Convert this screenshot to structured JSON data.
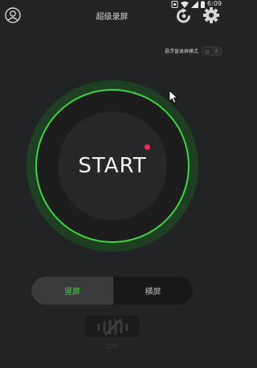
{
  "status": {
    "time": "6:09"
  },
  "header": {
    "title": "超级录屏"
  },
  "float_window": {
    "label": "悬浮窗录屏模式",
    "state": "关"
  },
  "main": {
    "start_label": "START"
  },
  "orientation": {
    "portrait": "竖屏",
    "landscape": "横屏",
    "selected": "portrait"
  },
  "audio": {
    "label": "OFF"
  },
  "colors": {
    "accent": "#3fd443",
    "record_dot": "#ee2c5a",
    "background": "#222324"
  }
}
